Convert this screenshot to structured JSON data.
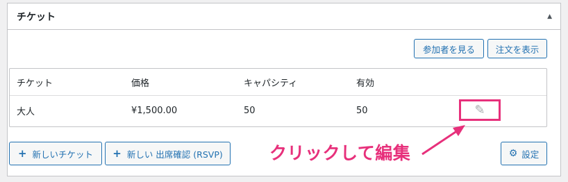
{
  "panel": {
    "title": "チケット",
    "collapse_icon": "triangle-up-icon"
  },
  "toolbar": {
    "view_attendees_label": "参加者を見る",
    "view_orders_label": "注文を表示"
  },
  "table": {
    "headers": [
      "チケット",
      "価格",
      "キャパシティ",
      "有効"
    ],
    "rows": [
      {
        "name": "大人",
        "price": "¥1,500.00",
        "capacity": "50",
        "available": "50"
      }
    ],
    "edit_icon": "pencil-icon"
  },
  "footer": {
    "new_ticket_label": "新しいチケット",
    "new_rsvp_label": "新しい 出席確認 (RSVP)",
    "settings_label": "設定"
  },
  "annotation": {
    "text": "クリックして編集",
    "color": "#e7307b"
  }
}
